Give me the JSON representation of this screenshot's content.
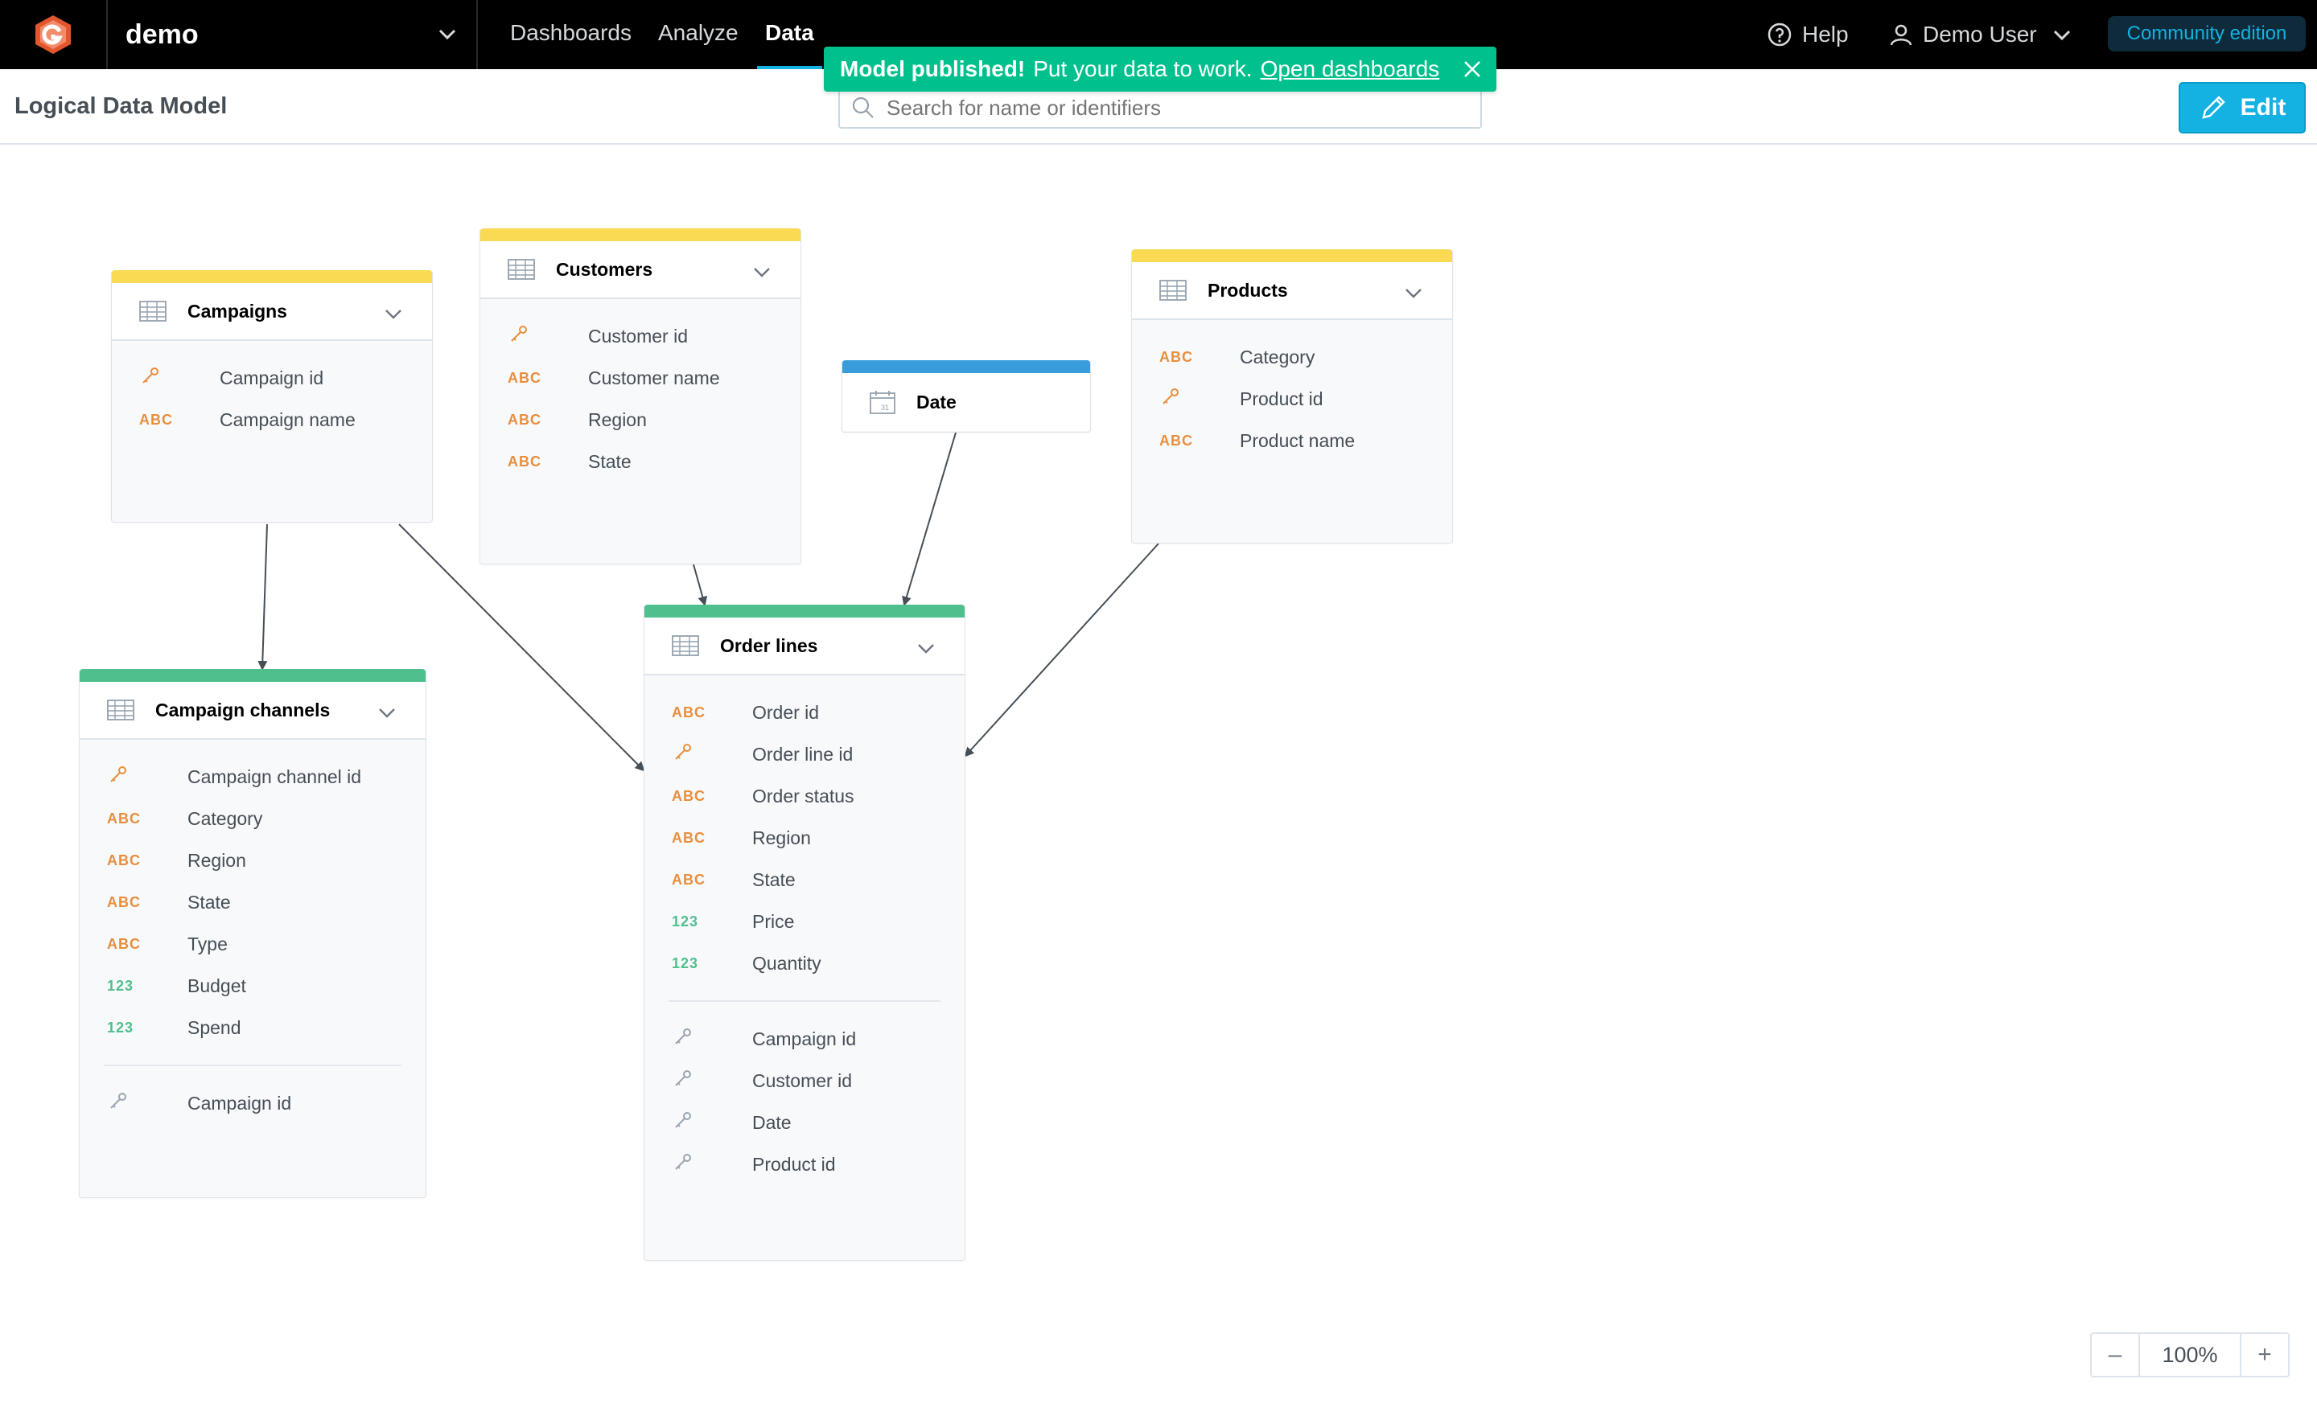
{
  "workspace": {
    "name": "demo"
  },
  "nav": {
    "dashboards": "Dashboards",
    "analyze": "Analyze",
    "data": "Data",
    "help": "Help",
    "user": "Demo User",
    "edition": "Community edition"
  },
  "header": {
    "title": "Logical Data Model",
    "search_placeholder": "Search for name or identifiers",
    "edit_label": "Edit"
  },
  "toast": {
    "strong": "Model published!",
    "message": "Put your data to work.",
    "link": "Open dashboards"
  },
  "colors": {
    "accent": "#14b2e2",
    "toast": "#00c18d",
    "dataset_bar_yellow": "#fad953",
    "dataset_bar_green": "#4fc08d",
    "date_bar_blue": "#3a9ddb",
    "attribute_label": "#e98e3d",
    "fact_label": "#4fc08d"
  },
  "datasets": {
    "campaigns": {
      "title": "Campaigns",
      "fields": [
        {
          "type": "key",
          "name": "Campaign id"
        },
        {
          "type": "ABC",
          "name": "Campaign name"
        }
      ]
    },
    "customers": {
      "title": "Customers",
      "fields": [
        {
          "type": "key",
          "name": "Customer id"
        },
        {
          "type": "ABC",
          "name": "Customer name"
        },
        {
          "type": "ABC",
          "name": "Region"
        },
        {
          "type": "ABC",
          "name": "State"
        }
      ]
    },
    "date": {
      "title": "Date"
    },
    "products": {
      "title": "Products",
      "fields": [
        {
          "type": "ABC",
          "name": "Category"
        },
        {
          "type": "key",
          "name": "Product id"
        },
        {
          "type": "ABC",
          "name": "Product name"
        }
      ]
    },
    "campaign_channels": {
      "title": "Campaign channels",
      "fields": [
        {
          "type": "key",
          "name": "Campaign channel id"
        },
        {
          "type": "ABC",
          "name": "Category"
        },
        {
          "type": "ABC",
          "name": "Region"
        },
        {
          "type": "ABC",
          "name": "State"
        },
        {
          "type": "ABC",
          "name": "Type"
        },
        {
          "type": "123",
          "name": "Budget"
        },
        {
          "type": "123",
          "name": "Spend"
        }
      ],
      "references": [
        {
          "type": "ref",
          "name": "Campaign id"
        }
      ]
    },
    "order_lines": {
      "title": "Order lines",
      "fields": [
        {
          "type": "ABC",
          "name": "Order id"
        },
        {
          "type": "key",
          "name": "Order line id"
        },
        {
          "type": "ABC",
          "name": "Order status"
        },
        {
          "type": "ABC",
          "name": "Region"
        },
        {
          "type": "ABC",
          "name": "State"
        },
        {
          "type": "123",
          "name": "Price"
        },
        {
          "type": "123",
          "name": "Quantity"
        }
      ],
      "references": [
        {
          "type": "ref",
          "name": "Campaign id"
        },
        {
          "type": "ref",
          "name": "Customer id"
        },
        {
          "type": "ref",
          "name": "Date"
        },
        {
          "type": "ref",
          "name": "Product id"
        }
      ]
    }
  },
  "zoom": {
    "minus": "–",
    "value": "100%",
    "plus": "+"
  }
}
